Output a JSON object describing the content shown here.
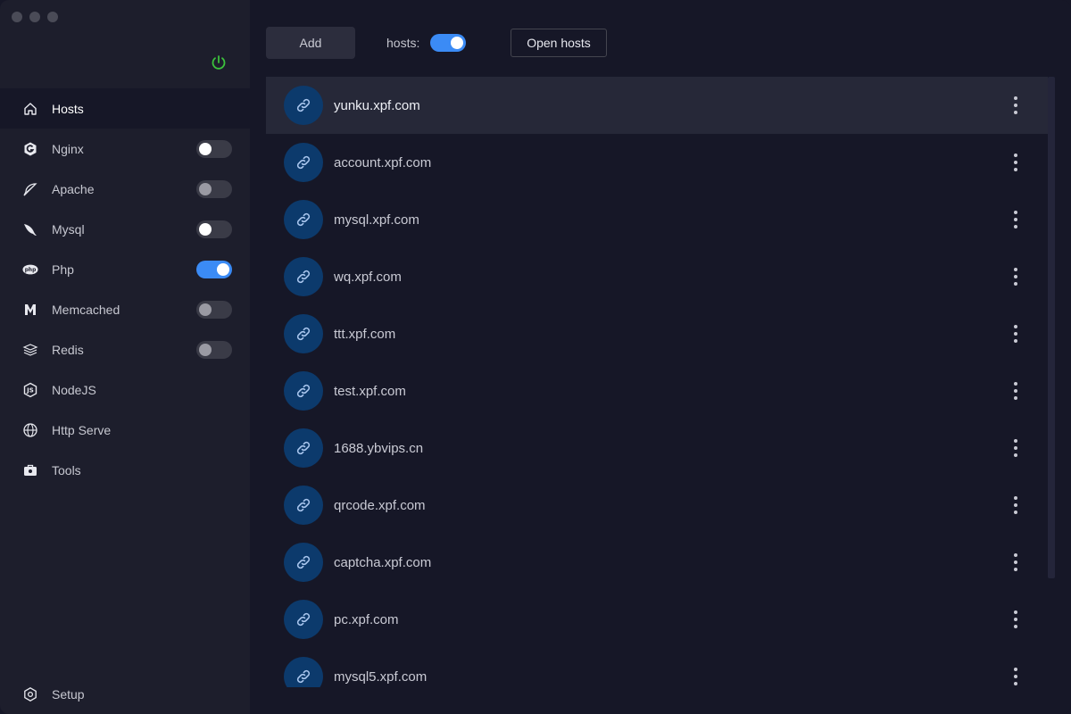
{
  "sidebar": {
    "items": [
      {
        "label": "Hosts",
        "icon": "home-icon",
        "toggle": null,
        "active": true
      },
      {
        "label": "Nginx",
        "icon": "nginx-icon",
        "toggle": "off"
      },
      {
        "label": "Apache",
        "icon": "apache-feather-icon",
        "toggle": "off-dim"
      },
      {
        "label": "Mysql",
        "icon": "mysql-dolphin-icon",
        "toggle": "off"
      },
      {
        "label": "Php",
        "icon": "php-icon",
        "toggle": "on"
      },
      {
        "label": "Memcached",
        "icon": "memcached-icon",
        "toggle": "off-dim"
      },
      {
        "label": "Redis",
        "icon": "redis-stack-icon",
        "toggle": "off-dim"
      },
      {
        "label": "NodeJS",
        "icon": "nodejs-hexagon-icon",
        "toggle": null
      },
      {
        "label": "Http Serve",
        "icon": "globe-icon",
        "toggle": null
      },
      {
        "label": "Tools",
        "icon": "toolbox-icon",
        "toggle": null
      }
    ],
    "setup_label": "Setup"
  },
  "toolbar": {
    "add_label": "Add",
    "hosts_label": "hosts:",
    "hosts_enabled": true,
    "open_hosts_label": "Open hosts"
  },
  "hosts": [
    "yunku.xpf.com",
    "account.xpf.com",
    "mysql.xpf.com",
    "wq.xpf.com",
    "ttt.xpf.com",
    "test.xpf.com",
    "1688.ybvips.cn",
    "qrcode.xpf.com",
    "captcha.xpf.com",
    "pc.xpf.com",
    "mysql5.xpf.com"
  ],
  "colors": {
    "accent": "#3b8bf5",
    "power": "#3cc13c",
    "avatar": "#0c3a6c"
  }
}
